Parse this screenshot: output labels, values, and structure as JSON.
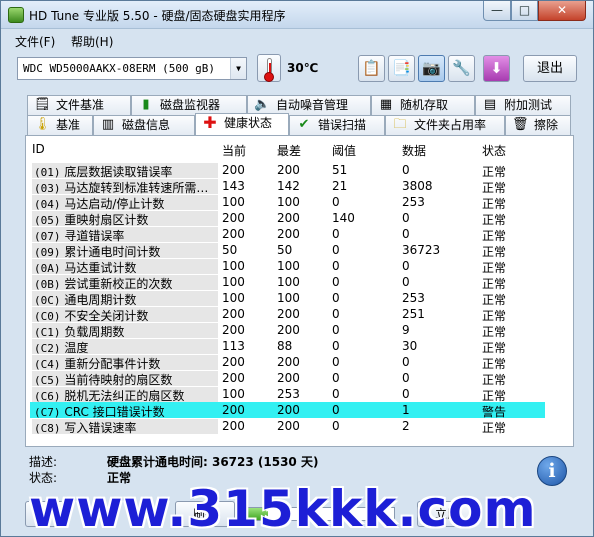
{
  "window": {
    "title": "HD Tune 专业版 5.50 - 硬盘/固态硬盘实用程序",
    "minimize": "—",
    "maximize": "□",
    "close": "✕"
  },
  "menu": [
    "文件(F)",
    "帮助(H)"
  ],
  "toolbar": {
    "drive": "WDC WD5000AAKX-08ERM (500 gB)",
    "temperature": "30℃",
    "exit_label": "退出",
    "icons": [
      "copy-text-icon",
      "copy-screenshot-icon",
      "camera-icon",
      "settings-icon",
      "save-download-icon"
    ]
  },
  "tabs_top": [
    {
      "icon": "file-benchmark-icon",
      "label": "文件基准"
    },
    {
      "icon": "disk-monitor-icon",
      "label": "磁盘监视器"
    },
    {
      "icon": "speaker-icon",
      "label": "自动噪音管理"
    },
    {
      "icon": "random-access-icon",
      "label": "随机存取"
    },
    {
      "icon": "extra-tests-icon",
      "label": "附加测试"
    }
  ],
  "tabs_bottom": [
    {
      "icon": "thermometer-icon",
      "label": "基准"
    },
    {
      "icon": "disk-info-icon",
      "label": "磁盘信息"
    },
    {
      "icon": "health-cross-icon",
      "label": "健康状态",
      "active": true
    },
    {
      "icon": "error-scan-icon",
      "label": "错误扫描"
    },
    {
      "icon": "folder-icon",
      "label": "文件夹占用率"
    },
    {
      "icon": "trash-icon",
      "label": "擦除"
    }
  ],
  "table": {
    "columns": [
      "ID",
      "当前",
      "最差",
      "阈值",
      "数据",
      "状态"
    ],
    "rows": [
      {
        "code": "(01)",
        "name": "底层数据读取错误率",
        "current": "200",
        "worst": "200",
        "threshold": "51",
        "data": "0",
        "status": "正常"
      },
      {
        "code": "(03)",
        "name": "马达旋转到标准转速所需…",
        "current": "143",
        "worst": "142",
        "threshold": "21",
        "data": "3808",
        "status": "正常"
      },
      {
        "code": "(04)",
        "name": "马达启动/停止计数",
        "current": "100",
        "worst": "100",
        "threshold": "0",
        "data": "253",
        "status": "正常"
      },
      {
        "code": "(05)",
        "name": "重映射扇区计数",
        "current": "200",
        "worst": "200",
        "threshold": "140",
        "data": "0",
        "status": "正常"
      },
      {
        "code": "(07)",
        "name": "寻道错误率",
        "current": "200",
        "worst": "200",
        "threshold": "0",
        "data": "0",
        "status": "正常"
      },
      {
        "code": "(09)",
        "name": "累计通电时间计数",
        "current": "50",
        "worst": "50",
        "threshold": "0",
        "data": "36723",
        "status": "正常"
      },
      {
        "code": "(0A)",
        "name": "马达重试计数",
        "current": "100",
        "worst": "100",
        "threshold": "0",
        "data": "0",
        "status": "正常"
      },
      {
        "code": "(0B)",
        "name": "尝试重新校正的次数",
        "current": "100",
        "worst": "100",
        "threshold": "0",
        "data": "0",
        "status": "正常"
      },
      {
        "code": "(0C)",
        "name": "通电周期计数",
        "current": "100",
        "worst": "100",
        "threshold": "0",
        "data": "253",
        "status": "正常"
      },
      {
        "code": "(C0)",
        "name": "不安全关闭计数",
        "current": "200",
        "worst": "200",
        "threshold": "0",
        "data": "251",
        "status": "正常"
      },
      {
        "code": "(C1)",
        "name": "负载周期数",
        "current": "200",
        "worst": "200",
        "threshold": "0",
        "data": "9",
        "status": "正常"
      },
      {
        "code": "(C2)",
        "name": "温度",
        "current": "113",
        "worst": "88",
        "threshold": "0",
        "data": "30",
        "status": "正常"
      },
      {
        "code": "(C4)",
        "name": "重新分配事件计数",
        "current": "200",
        "worst": "200",
        "threshold": "0",
        "data": "0",
        "status": "正常"
      },
      {
        "code": "(C5)",
        "name": "当前待映射的扇区数",
        "current": "200",
        "worst": "200",
        "threshold": "0",
        "data": "0",
        "status": "正常"
      },
      {
        "code": "(C6)",
        "name": "脱机无法纠正的扇区数",
        "current": "100",
        "worst": "253",
        "threshold": "0",
        "data": "0",
        "status": "正常"
      },
      {
        "code": "(C7)",
        "name": "CRC 接口错误计数",
        "current": "200",
        "worst": "200",
        "threshold": "0",
        "data": "1",
        "status": "警告",
        "alert": true
      },
      {
        "code": "(C8)",
        "name": "写入错误速率",
        "current": "200",
        "worst": "200",
        "threshold": "0",
        "data": "2",
        "status": "正常"
      }
    ]
  },
  "info": {
    "desc_label": "描述:",
    "desc_value": "硬盘累计通电时间: 36723 (1530 天)",
    "status_label": "状态:",
    "status_value": "正常"
  },
  "bottom": {
    "left_label": "健",
    "mid_label": "刷新",
    "right_label": "立即",
    "progress_fraction": 0.15
  },
  "watermark": "www.315kkk.com",
  "colors": {
    "alert_row": "#33f0f2",
    "watermark": "#1d1fd6"
  }
}
